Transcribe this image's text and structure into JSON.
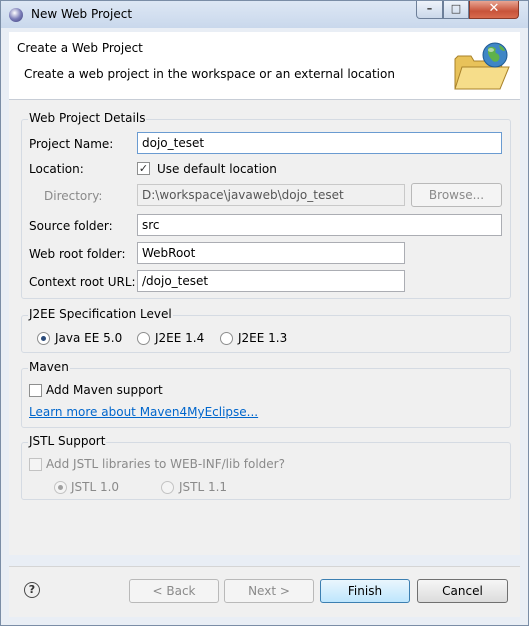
{
  "window": {
    "title": "New Web Project"
  },
  "header": {
    "title": "Create a Web Project",
    "description": "Create a web project in the workspace or an external location"
  },
  "details": {
    "legend": "Web Project Details",
    "project_name_label": "Project Name:",
    "project_name_value": "dojo_teset",
    "location_label": "Location:",
    "use_default_location_label": "Use default location",
    "use_default_location_checked": true,
    "directory_label": "Directory:",
    "directory_value": "D:\\workspace\\javaweb\\dojo_teset",
    "browse_label": "Browse...",
    "source_folder_label": "Source folder:",
    "source_folder_value": "src",
    "web_root_label": "Web root folder:",
    "web_root_value": "WebRoot",
    "context_root_label": "Context root URL:",
    "context_root_value": "/dojo_teset"
  },
  "j2ee": {
    "legend": "J2EE Specification Level",
    "options": [
      "Java EE 5.0",
      "J2EE 1.4",
      "J2EE 1.3"
    ],
    "selected": "Java EE 5.0"
  },
  "maven": {
    "legend": "Maven",
    "add_support_label": "Add Maven support",
    "add_support_checked": false,
    "learn_more_link": "Learn more about Maven4MyEclipse..."
  },
  "jstl": {
    "legend": "JSTL Support",
    "add_libraries_label": "Add JSTL libraries to WEB-INF/lib folder?",
    "add_libraries_checked": false,
    "options": [
      "JSTL 1.0",
      "JSTL 1.1"
    ],
    "selected": "JSTL 1.0"
  },
  "footer": {
    "help_glyph": "?",
    "back_label": "< Back",
    "next_label": "Next >",
    "finish_label": "Finish",
    "cancel_label": "Cancel"
  },
  "icons": {
    "app": "myeclipse-icon",
    "wizard": "web-project-folder-globe-icon",
    "help": "help-icon"
  },
  "colors": {
    "link": "#0066cc",
    "focus_border": "#6a9bd1",
    "close_button": "#c8533a"
  }
}
